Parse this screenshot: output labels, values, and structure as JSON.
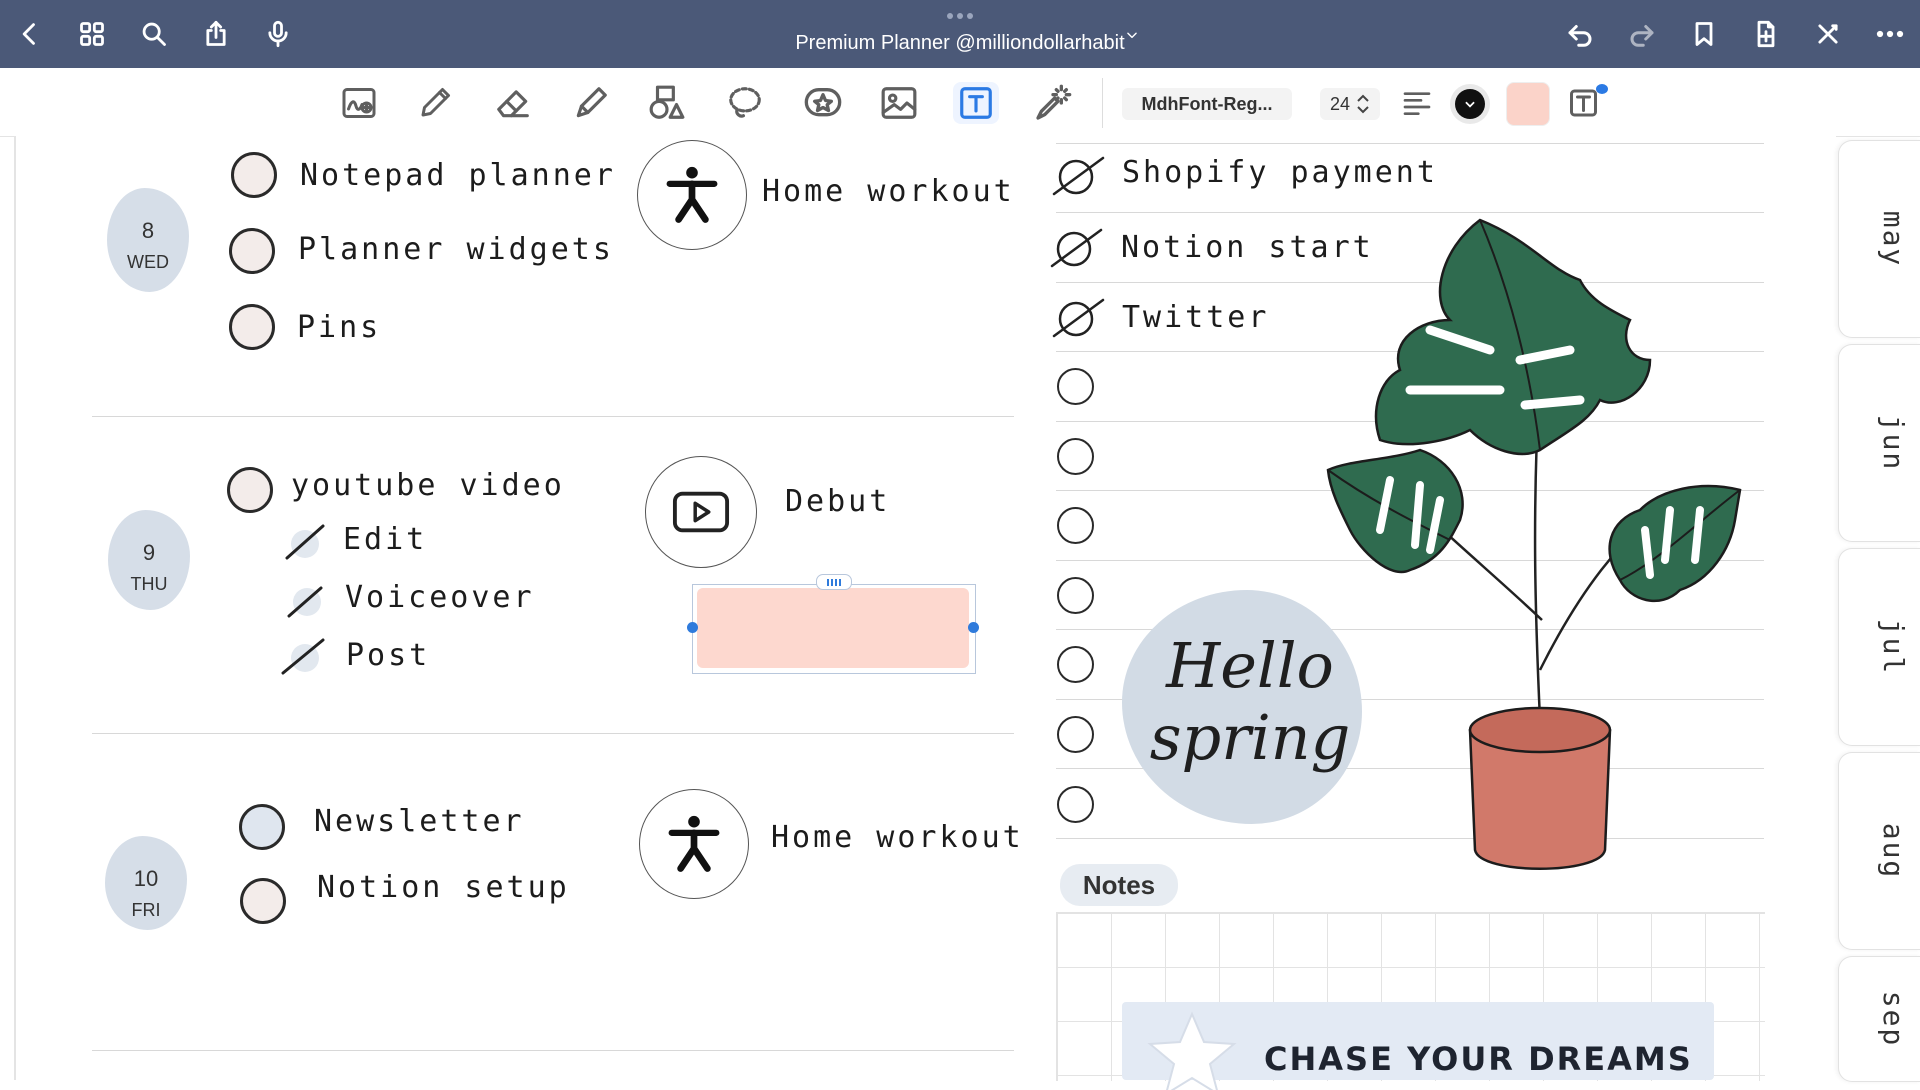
{
  "titlebar": {
    "title": "Premium Planner @milliondollarhabit",
    "icons": [
      "back-icon",
      "grid-icon",
      "search-icon",
      "share-icon",
      "mic-icon",
      "undo-icon",
      "redo-icon",
      "bookmark-icon",
      "add-page-icon",
      "close-icon",
      "more-icon"
    ]
  },
  "toolbar": {
    "tools": [
      "zoom-window-tool",
      "pen-tool",
      "eraser-tool",
      "highlighter-tool",
      "shapes-tool",
      "lasso-tool",
      "sticker-tool",
      "image-tool",
      "text-tool",
      "laser-pointer-tool"
    ],
    "active_tool": "text-tool",
    "font_name": "MdhFont-Reg...",
    "font_size": "24",
    "text_color": "#111111",
    "fill_color": "#fbd3c9"
  },
  "days": [
    {
      "num": "8",
      "dow": "WED",
      "tasks": [
        "Notepad planner",
        "Planner widgets",
        "Pins"
      ],
      "activity": "Home workout"
    },
    {
      "num": "9",
      "dow": "THU",
      "tasks": [
        "youtube video"
      ],
      "subtasks": [
        "Edit",
        "Voiceover",
        "Post"
      ],
      "activity": "Debut"
    },
    {
      "num": "10",
      "dow": "FRI",
      "tasks": [
        "Newsletter",
        "Notion setup"
      ],
      "activity": "Home workout"
    }
  ],
  "checklist": {
    "done": [
      "Shopify payment",
      "Notion start",
      "Twitter"
    ],
    "empty_count": 7
  },
  "sticker": {
    "hello_line1": "Hello",
    "hello_line2": "spring",
    "dream": "CHASE YOUR DREAMS"
  },
  "notes": {
    "label": "Notes"
  },
  "months": [
    "may",
    "jun",
    "jul",
    "aug",
    "sep"
  ],
  "colors": {
    "titlebar": "#4b5978",
    "accent": "#2b7ae4",
    "pot": "#d1796a",
    "leaf": "#2f6b4f",
    "date_blob": "#d6dee8"
  }
}
